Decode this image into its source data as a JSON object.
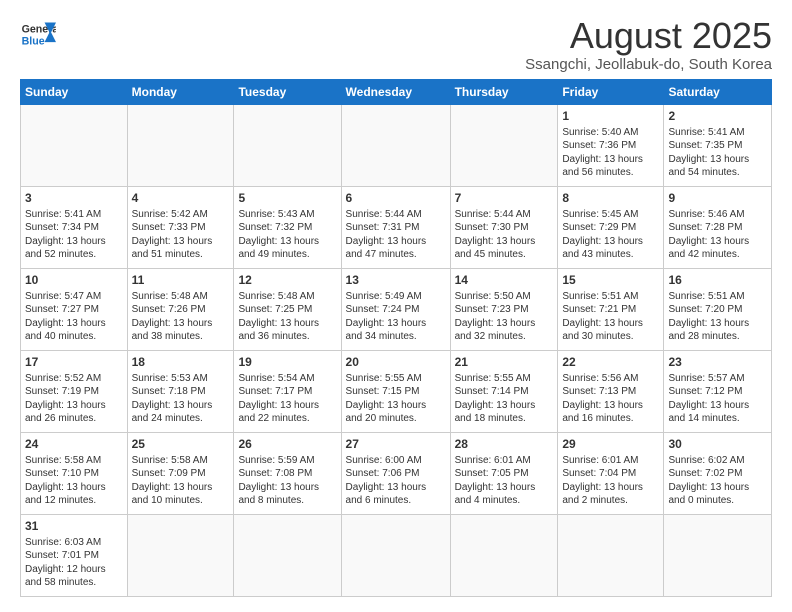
{
  "header": {
    "logo_general": "General",
    "logo_blue": "Blue",
    "month_title": "August 2025",
    "location": "Ssangchi, Jeollabuk-do, South Korea"
  },
  "days_of_week": [
    "Sunday",
    "Monday",
    "Tuesday",
    "Wednesday",
    "Thursday",
    "Friday",
    "Saturday"
  ],
  "weeks": [
    [
      {
        "day": "",
        "info": ""
      },
      {
        "day": "",
        "info": ""
      },
      {
        "day": "",
        "info": ""
      },
      {
        "day": "",
        "info": ""
      },
      {
        "day": "",
        "info": ""
      },
      {
        "day": "1",
        "info": "Sunrise: 5:40 AM\nSunset: 7:36 PM\nDaylight: 13 hours and 56 minutes."
      },
      {
        "day": "2",
        "info": "Sunrise: 5:41 AM\nSunset: 7:35 PM\nDaylight: 13 hours and 54 minutes."
      }
    ],
    [
      {
        "day": "3",
        "info": "Sunrise: 5:41 AM\nSunset: 7:34 PM\nDaylight: 13 hours and 52 minutes."
      },
      {
        "day": "4",
        "info": "Sunrise: 5:42 AM\nSunset: 7:33 PM\nDaylight: 13 hours and 51 minutes."
      },
      {
        "day": "5",
        "info": "Sunrise: 5:43 AM\nSunset: 7:32 PM\nDaylight: 13 hours and 49 minutes."
      },
      {
        "day": "6",
        "info": "Sunrise: 5:44 AM\nSunset: 7:31 PM\nDaylight: 13 hours and 47 minutes."
      },
      {
        "day": "7",
        "info": "Sunrise: 5:44 AM\nSunset: 7:30 PM\nDaylight: 13 hours and 45 minutes."
      },
      {
        "day": "8",
        "info": "Sunrise: 5:45 AM\nSunset: 7:29 PM\nDaylight: 13 hours and 43 minutes."
      },
      {
        "day": "9",
        "info": "Sunrise: 5:46 AM\nSunset: 7:28 PM\nDaylight: 13 hours and 42 minutes."
      }
    ],
    [
      {
        "day": "10",
        "info": "Sunrise: 5:47 AM\nSunset: 7:27 PM\nDaylight: 13 hours and 40 minutes."
      },
      {
        "day": "11",
        "info": "Sunrise: 5:48 AM\nSunset: 7:26 PM\nDaylight: 13 hours and 38 minutes."
      },
      {
        "day": "12",
        "info": "Sunrise: 5:48 AM\nSunset: 7:25 PM\nDaylight: 13 hours and 36 minutes."
      },
      {
        "day": "13",
        "info": "Sunrise: 5:49 AM\nSunset: 7:24 PM\nDaylight: 13 hours and 34 minutes."
      },
      {
        "day": "14",
        "info": "Sunrise: 5:50 AM\nSunset: 7:23 PM\nDaylight: 13 hours and 32 minutes."
      },
      {
        "day": "15",
        "info": "Sunrise: 5:51 AM\nSunset: 7:21 PM\nDaylight: 13 hours and 30 minutes."
      },
      {
        "day": "16",
        "info": "Sunrise: 5:51 AM\nSunset: 7:20 PM\nDaylight: 13 hours and 28 minutes."
      }
    ],
    [
      {
        "day": "17",
        "info": "Sunrise: 5:52 AM\nSunset: 7:19 PM\nDaylight: 13 hours and 26 minutes."
      },
      {
        "day": "18",
        "info": "Sunrise: 5:53 AM\nSunset: 7:18 PM\nDaylight: 13 hours and 24 minutes."
      },
      {
        "day": "19",
        "info": "Sunrise: 5:54 AM\nSunset: 7:17 PM\nDaylight: 13 hours and 22 minutes."
      },
      {
        "day": "20",
        "info": "Sunrise: 5:55 AM\nSunset: 7:15 PM\nDaylight: 13 hours and 20 minutes."
      },
      {
        "day": "21",
        "info": "Sunrise: 5:55 AM\nSunset: 7:14 PM\nDaylight: 13 hours and 18 minutes."
      },
      {
        "day": "22",
        "info": "Sunrise: 5:56 AM\nSunset: 7:13 PM\nDaylight: 13 hours and 16 minutes."
      },
      {
        "day": "23",
        "info": "Sunrise: 5:57 AM\nSunset: 7:12 PM\nDaylight: 13 hours and 14 minutes."
      }
    ],
    [
      {
        "day": "24",
        "info": "Sunrise: 5:58 AM\nSunset: 7:10 PM\nDaylight: 13 hours and 12 minutes."
      },
      {
        "day": "25",
        "info": "Sunrise: 5:58 AM\nSunset: 7:09 PM\nDaylight: 13 hours and 10 minutes."
      },
      {
        "day": "26",
        "info": "Sunrise: 5:59 AM\nSunset: 7:08 PM\nDaylight: 13 hours and 8 minutes."
      },
      {
        "day": "27",
        "info": "Sunrise: 6:00 AM\nSunset: 7:06 PM\nDaylight: 13 hours and 6 minutes."
      },
      {
        "day": "28",
        "info": "Sunrise: 6:01 AM\nSunset: 7:05 PM\nDaylight: 13 hours and 4 minutes."
      },
      {
        "day": "29",
        "info": "Sunrise: 6:01 AM\nSunset: 7:04 PM\nDaylight: 13 hours and 2 minutes."
      },
      {
        "day": "30",
        "info": "Sunrise: 6:02 AM\nSunset: 7:02 PM\nDaylight: 13 hours and 0 minutes."
      }
    ],
    [
      {
        "day": "31",
        "info": "Sunrise: 6:03 AM\nSunset: 7:01 PM\nDaylight: 12 hours and 58 minutes."
      },
      {
        "day": "",
        "info": ""
      },
      {
        "day": "",
        "info": ""
      },
      {
        "day": "",
        "info": ""
      },
      {
        "day": "",
        "info": ""
      },
      {
        "day": "",
        "info": ""
      },
      {
        "day": "",
        "info": ""
      }
    ]
  ]
}
